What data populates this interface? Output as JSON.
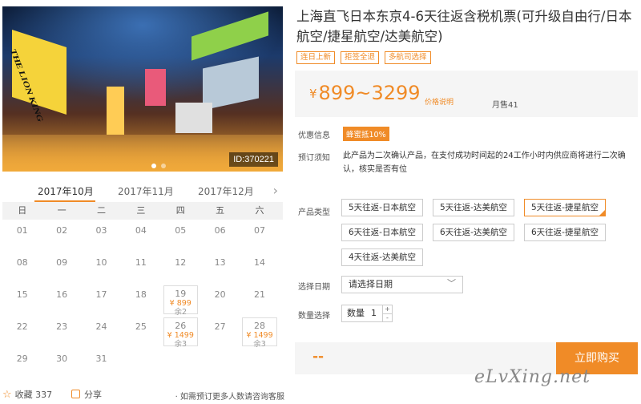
{
  "gallery": {
    "image_id": "ID:370221",
    "slides": 2,
    "active_slide": 1,
    "image_sign_text": "THE LION KING"
  },
  "calendar": {
    "months": [
      "2017年10月",
      "2017年11月",
      "2017年12月"
    ],
    "active_month": 0,
    "weekdays": [
      "日",
      "一",
      "二",
      "三",
      "四",
      "五",
      "六"
    ],
    "weeks": [
      [
        {
          "d": "01"
        },
        {
          "d": "02"
        },
        {
          "d": "03"
        },
        {
          "d": "04"
        },
        {
          "d": "05"
        },
        {
          "d": "06"
        },
        {
          "d": "07"
        }
      ],
      [
        {
          "d": "08"
        },
        {
          "d": "09"
        },
        {
          "d": "10"
        },
        {
          "d": "11"
        },
        {
          "d": "12"
        },
        {
          "d": "13"
        },
        {
          "d": "14"
        }
      ],
      [
        {
          "d": "15"
        },
        {
          "d": "16"
        },
        {
          "d": "17"
        },
        {
          "d": "18"
        },
        {
          "d": "19",
          "price": "¥ 899",
          "remain": "余2"
        },
        {
          "d": "20"
        },
        {
          "d": "21"
        }
      ],
      [
        {
          "d": "22"
        },
        {
          "d": "23"
        },
        {
          "d": "24"
        },
        {
          "d": "25"
        },
        {
          "d": "26",
          "price": "¥ 1499",
          "remain": "余3"
        },
        {
          "d": "27"
        },
        {
          "d": "28",
          "price": "¥ 1499",
          "remain": "余3"
        }
      ],
      [
        {
          "d": "29"
        },
        {
          "d": "30"
        },
        {
          "d": "31"
        }
      ]
    ]
  },
  "footer": {
    "favorite_label": "收藏",
    "favorite_count": "337",
    "share_label": "分享",
    "hint": "· 如需预订更多人数请咨询客服"
  },
  "product": {
    "title": "上海直飞日本东京4-6天往返含税机票(可升级自由行/日本航空/捷星航空/达美航空)",
    "tags": [
      "连日上新",
      "拒签全退",
      "多航司选择"
    ],
    "price_prefix": "¥",
    "price_range": "899~3299",
    "price_note": "价格说明",
    "monthly_sales": "月售41",
    "promo_label": "优惠信息",
    "promo_value": "蜂蜜抵10%",
    "notice_label": "预订须知",
    "notice_text": "此产品为二次确认产品，在支付成功时间起的24工作小时内供应商将进行二次确认，核实是否有位",
    "type_label": "产品类型",
    "types": [
      "5天往返-日本航空",
      "5天往返-达美航空",
      "5天往返-捷星航空",
      "6天往返-日本航空",
      "6天往返-达美航空",
      "6天往返-捷星航空",
      "4天往返-达美航空"
    ],
    "selected_type": 2,
    "date_label": "选择日期",
    "date_placeholder": "请选择日期",
    "qty_label": "数量选择",
    "qty_name": "数量",
    "qty_value": "1",
    "total": "--",
    "buy_label": "立即购买",
    "watermark": "eLvXing.net"
  },
  "colors": {
    "accent": "#f08b27",
    "panel": "#f5f5f5"
  }
}
